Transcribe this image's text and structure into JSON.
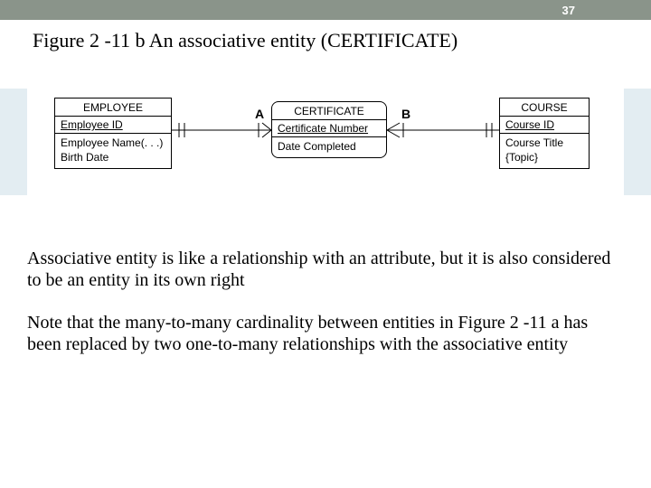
{
  "page": {
    "number": "37"
  },
  "figure": {
    "title": "Figure 2 -11 b An associative entity (CERTIFICATE)"
  },
  "diagram": {
    "relA": "A",
    "relB": "B",
    "employee": {
      "name": "EMPLOYEE",
      "pk": "Employee ID",
      "attr1": "Employee Name(. . .)",
      "attr2": "Birth Date"
    },
    "certificate": {
      "name": "CERTIFICATE",
      "pk": "Certificate Number",
      "attr1": "Date Completed"
    },
    "course": {
      "name": "COURSE",
      "pk": "Course ID",
      "attr1": "Course Title",
      "attr2": "{Topic}"
    }
  },
  "body": {
    "p1": "Associative entity is like a relationship with an attribute, but it is also considered to be an entity in its own right",
    "p2": "Note that the many-to-many cardinality between entities in Figure 2 -11 a has been replaced by two one-to-many relationships with the associative entity"
  }
}
